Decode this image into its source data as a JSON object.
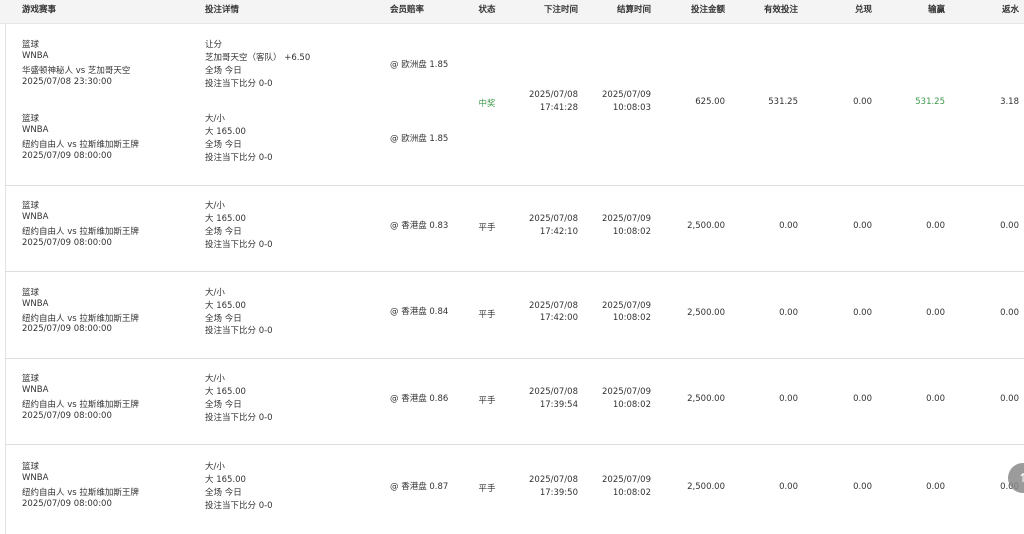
{
  "headers": {
    "game": "游戏赛事",
    "details": "投注详情",
    "odds": "会员赔率",
    "status": "状态",
    "bet_time": "下注时间",
    "settle_time": "结算时间",
    "amount": "投注金额",
    "valid": "有效投注",
    "cashout": "兑现",
    "winloss": "输赢",
    "rebate": "返水"
  },
  "rows": [
    {
      "status": "中奖",
      "bet_date": "2025/07/08",
      "bet_clock": "17:41:28",
      "settle_date": "2025/07/09",
      "settle_clock": "10:08:03",
      "amount": "625.00",
      "valid": "531.25",
      "cashout": "0.00",
      "winloss": "531.25",
      "rebate": "3.18",
      "legs": [
        {
          "sport": "篮球",
          "league": "WNBA",
          "match": "华盛顿神秘人 vs 芝加哥天空",
          "time": "2025/07/08 23:30:00",
          "bet_type": "让分",
          "selection": "芝加哥天空（客队） +6.50",
          "period": "全场 今日",
          "score": "投注当下比分 0-0",
          "odds": "@ 欧洲盘 1.85"
        },
        {
          "sport": "篮球",
          "league": "WNBA",
          "match": "纽约自由人 vs 拉斯维加斯王牌",
          "time": "2025/07/09 08:00:00",
          "bet_type": "大/小",
          "selection": "大 165.00",
          "period": "全场 今日",
          "score": "投注当下比分 0-0",
          "odds": "@ 欧洲盘 1.85"
        }
      ]
    },
    {
      "status": "平手",
      "bet_date": "2025/07/08",
      "bet_clock": "17:42:10",
      "settle_date": "2025/07/09",
      "settle_clock": "10:08:02",
      "amount": "2,500.00",
      "valid": "0.00",
      "cashout": "0.00",
      "winloss": "0.00",
      "rebate": "0.00",
      "legs": [
        {
          "sport": "篮球",
          "league": "WNBA",
          "match": "纽约自由人 vs 拉斯维加斯王牌",
          "time": "2025/07/09 08:00:00",
          "bet_type": "大/小",
          "selection": "大 165.00",
          "period": "全场 今日",
          "score": "投注当下比分 0-0",
          "odds": "@ 香港盘 0.83"
        }
      ]
    },
    {
      "status": "平手",
      "bet_date": "2025/07/08",
      "bet_clock": "17:42:00",
      "settle_date": "2025/07/09",
      "settle_clock": "10:08:02",
      "amount": "2,500.00",
      "valid": "0.00",
      "cashout": "0.00",
      "winloss": "0.00",
      "rebate": "0.00",
      "legs": [
        {
          "sport": "篮球",
          "league": "WNBA",
          "match": "纽约自由人 vs 拉斯维加斯王牌",
          "time": "2025/07/09 08:00:00",
          "bet_type": "大/小",
          "selection": "大 165.00",
          "period": "全场 今日",
          "score": "投注当下比分 0-0",
          "odds": "@ 香港盘 0.84"
        }
      ]
    },
    {
      "status": "平手",
      "bet_date": "2025/07/08",
      "bet_clock": "17:39:54",
      "settle_date": "2025/07/09",
      "settle_clock": "10:08:02",
      "amount": "2,500.00",
      "valid": "0.00",
      "cashout": "0.00",
      "winloss": "0.00",
      "rebate": "0.00",
      "legs": [
        {
          "sport": "篮球",
          "league": "WNBA",
          "match": "纽约自由人 vs 拉斯维加斯王牌",
          "time": "2025/07/09 08:00:00",
          "bet_type": "大/小",
          "selection": "大 165.00",
          "period": "全场 今日",
          "score": "投注当下比分 0-0",
          "odds": "@ 香港盘 0.86"
        }
      ]
    },
    {
      "status": "平手",
      "bet_date": "2025/07/08",
      "bet_clock": "17:39:50",
      "settle_date": "2025/07/09",
      "settle_clock": "10:08:02",
      "amount": "2,500.00",
      "valid": "0.00",
      "cashout": "0.00",
      "winloss": "0.00",
      "rebate": "0.00",
      "legs": [
        {
          "sport": "篮球",
          "league": "WNBA",
          "match": "纽约自由人 vs 拉斯维加斯王牌",
          "time": "2025/07/09 08:00:00",
          "bet_type": "大/小",
          "selection": "大 165.00",
          "period": "全场 今日",
          "score": "投注当下比分 0-0",
          "odds": "@ 香港盘 0.87"
        }
      ]
    }
  ],
  "scroll_top_icon": "arrow-up-icon"
}
